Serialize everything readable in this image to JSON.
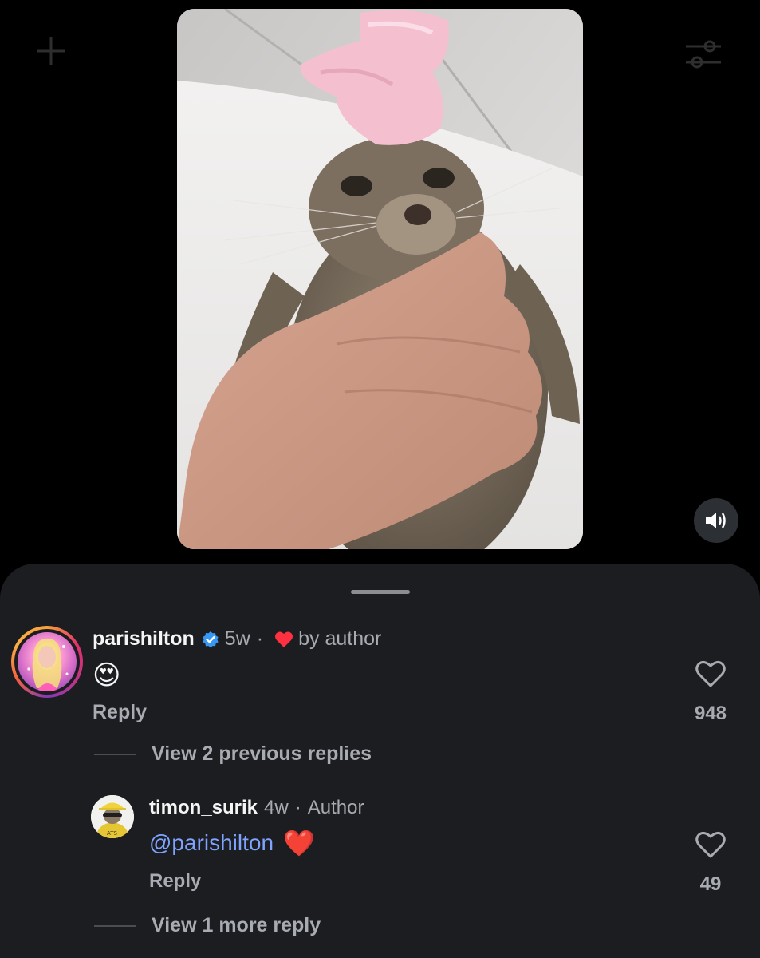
{
  "toolbar": {
    "left_icon": "plus-icon",
    "right_icon": "filter-icon"
  },
  "video": {
    "sound_icon": "speaker-icon"
  },
  "comments": [
    {
      "username": "parishilton",
      "time": "5w",
      "separator": "·",
      "liked_by_author_label": "by author",
      "text": "😍",
      "reply_label": "Reply",
      "like_count": "948",
      "view_replies_label": "View 2 previous replies"
    }
  ],
  "replies": [
    {
      "username": "timon_surik",
      "time": "4w",
      "separator": "·",
      "author_badge": "Author",
      "mention": "@parishilton",
      "text": "❤️",
      "reply_label": "Reply",
      "like_count": "49",
      "view_more_label": "View 1 more reply"
    }
  ],
  "colors": {
    "background": "#000000",
    "sheet": "#1b1d21",
    "muted_text": "#a8abb1",
    "mention": "#7fa3ff",
    "verified": "#3897f0",
    "heart": "#ff3040"
  }
}
